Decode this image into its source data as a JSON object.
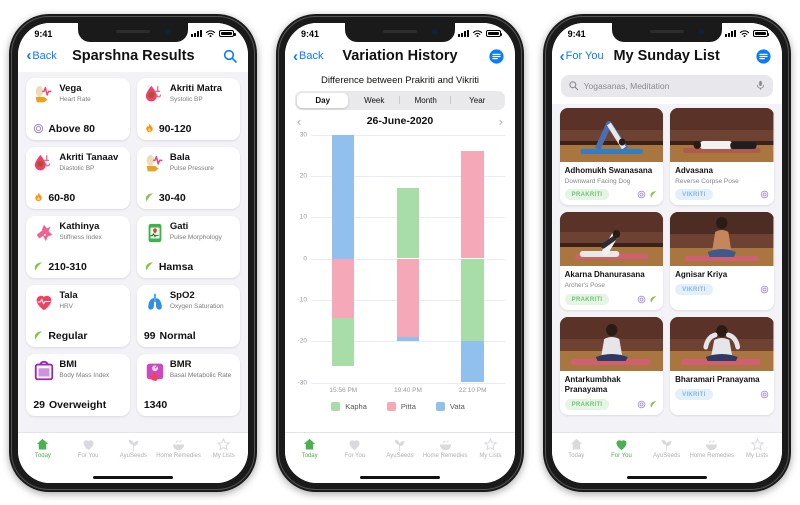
{
  "phones": [
    {
      "id": "sparshna-results",
      "status": {
        "time": "9:41"
      },
      "nav": {
        "back": "Back",
        "title": "Sparshna Results",
        "right_icon": "search-icon"
      },
      "cards": [
        {
          "title": "Vega",
          "sub": "Heart Rate",
          "icon": "pulse-hand-icon",
          "value_icon": "spiral-icon",
          "value": "Above 80"
        },
        {
          "title": "Akriti Matra",
          "sub": "Systolic BP",
          "icon": "blood-drop-icon",
          "value_icon": "flame-icon",
          "value": "90-120"
        },
        {
          "title": "Akriti Tanaav",
          "sub": "Diastolic BP",
          "icon": "blood-drop-icon",
          "value_icon": "flame-icon",
          "value": "60-80"
        },
        {
          "title": "Bala",
          "sub": "Pulse Pressure",
          "icon": "pulse-hand-icon",
          "value_icon": "leaf-icon",
          "value": "30-40"
        },
        {
          "title": "Kathinya",
          "sub": "Stiffness Index",
          "icon": "artery-icon",
          "value_icon": "leaf-icon",
          "value": "210-310"
        },
        {
          "title": "Gati",
          "sub": "Pulse Morphology",
          "icon": "phone-ecg-icon",
          "value_icon": "leaf-icon",
          "value": "Hamsa"
        },
        {
          "title": "Tala",
          "sub": "HRV",
          "icon": "heart-icon",
          "value_icon": "leaf-icon",
          "value": "Regular"
        },
        {
          "title": "SpO2",
          "sub": "Oxygen Saturation",
          "icon": "lungs-icon",
          "value_icon": "",
          "value": "99",
          "unit": "Normal"
        },
        {
          "title": "BMI",
          "sub": "Body Mass Index",
          "icon": "clipboard-icon",
          "value_icon": "",
          "value": "29",
          "unit": "Overweight"
        },
        {
          "title": "BMR",
          "sub": "Basal Metabolic Rate",
          "icon": "scale-flame-icon",
          "value_icon": "",
          "value": "1340",
          "unit": ""
        }
      ],
      "tabs": [
        {
          "label": "Today",
          "icon": "home-icon",
          "active": true
        },
        {
          "label": "For You",
          "icon": "heart-icon",
          "active": false
        },
        {
          "label": "AyuSeeds",
          "icon": "sprout-icon",
          "active": false
        },
        {
          "label": "Home Remedies",
          "icon": "bowl-icon",
          "active": false
        },
        {
          "label": "My Lists",
          "icon": "star-icon",
          "active": false
        }
      ]
    },
    {
      "id": "variation-history",
      "status": {
        "time": "9:41"
      },
      "nav": {
        "back": "Back",
        "title": "Variation History",
        "right_icon": "list-circle-icon"
      },
      "subtitle": "Difference between Prakriti and Vikriti",
      "segments": [
        {
          "label": "Day",
          "selected": true
        },
        {
          "label": "Week",
          "selected": false
        },
        {
          "label": "Month",
          "selected": false
        },
        {
          "label": "Year",
          "selected": false
        }
      ],
      "date": "26-June-2020",
      "tabs": [
        {
          "label": "Today",
          "icon": "home-icon",
          "active": true
        },
        {
          "label": "For You",
          "icon": "heart-icon",
          "active": false
        },
        {
          "label": "AyuSeeds",
          "icon": "sprout-icon",
          "active": false
        },
        {
          "label": "Home Remedies",
          "icon": "bowl-icon",
          "active": false
        },
        {
          "label": "My Lists",
          "icon": "star-icon",
          "active": false
        }
      ]
    },
    {
      "id": "my-sunday-list",
      "status": {
        "time": "9:41"
      },
      "nav": {
        "back": "For You",
        "title": "My Sunday List",
        "right_icon": "list-circle-icon"
      },
      "search": {
        "placeholder": "Yogasanas, Meditation",
        "icon": "search-icon",
        "mic_icon": "microphone-icon"
      },
      "items": [
        {
          "name": "Adhomukh Swanasana",
          "desc": "Downward Facing Dog",
          "pill": "PRAKRITI",
          "pill_type": "prakriti",
          "icons": [
            "spiral-icon",
            "leaf-icon"
          ],
          "pose": "downward-dog"
        },
        {
          "name": "Advasana",
          "desc": "Reverse Corpse Pose",
          "pill": "VIKRITI",
          "pill_type": "vikriti",
          "icons": [
            "spiral-icon"
          ],
          "pose": "prone-lying"
        },
        {
          "name": "Akarna Dhanurasana",
          "desc": "Archer's Pose",
          "pill": "PRAKRITI",
          "pill_type": "prakriti",
          "icons": [
            "spiral-icon",
            "leaf-icon"
          ],
          "pose": "seated-archer"
        },
        {
          "name": "Agnisar Kriya",
          "desc": "",
          "pill": "VIKRITI",
          "pill_type": "vikriti",
          "icons": [
            "spiral-icon"
          ],
          "pose": "seated-shirtless"
        },
        {
          "name": "Antarkumbhak Pranayama",
          "desc": "",
          "pill": "PRAKRITI",
          "pill_type": "prakriti",
          "icons": [
            "spiral-icon",
            "leaf-icon"
          ],
          "pose": "seated-meditate"
        },
        {
          "name": "Bharamari Pranayama",
          "desc": "",
          "pill": "VIKRITI",
          "pill_type": "vikriti",
          "icons": [
            "spiral-icon"
          ],
          "pose": "seated-ears"
        }
      ],
      "tabs": [
        {
          "label": "Today",
          "icon": "home-icon",
          "active": false
        },
        {
          "label": "For You",
          "icon": "heart-icon",
          "active": true
        },
        {
          "label": "AyuSeeds",
          "icon": "sprout-icon",
          "active": false
        },
        {
          "label": "Home Remedies",
          "icon": "bowl-icon",
          "active": false
        },
        {
          "label": "My Lists",
          "icon": "star-icon",
          "active": false
        }
      ]
    }
  ],
  "chart_data": {
    "type": "bar",
    "subtype": "stacked-diverging",
    "title": "Variation History",
    "subtitle": "Difference between Prakriti and Vikriti",
    "xlabel": "",
    "ylabel": "",
    "ylim": [
      -30,
      30
    ],
    "yticks": [
      30,
      20,
      10,
      0,
      -10,
      -20,
      -30
    ],
    "grid": true,
    "legend_position": "bottom",
    "categories": [
      "15:56 PM",
      "19:40 PM",
      "22:10 PM"
    ],
    "series": [
      {
        "name": "Kapha",
        "color": "#a8dda8",
        "values": [
          -11.5,
          17,
          20
        ]
      },
      {
        "name": "Pitta",
        "color": "#f5a9b8",
        "values": [
          -14.5,
          -19,
          26
        ]
      },
      {
        "name": "Vata",
        "color": "#92c0ee",
        "values": [
          30,
          -1,
          -10
        ]
      }
    ],
    "bars": [
      {
        "category": "15:56 PM",
        "stacks": [
          {
            "name": "Vata",
            "from": 0,
            "to": 30,
            "color": "#92c0ee"
          },
          {
            "name": "Pitta",
            "from": -14.5,
            "to": 0,
            "color": "#f5a9b8"
          },
          {
            "name": "Kapha",
            "from": -26,
            "to": -14.5,
            "color": "#a8dda8"
          }
        ]
      },
      {
        "category": "19:40 PM",
        "stacks": [
          {
            "name": "Kapha",
            "from": 0,
            "to": 17,
            "color": "#a8dda8"
          },
          {
            "name": "Pitta",
            "from": -19,
            "to": 0,
            "color": "#f5a9b8"
          },
          {
            "name": "Vata",
            "from": -20,
            "to": -19,
            "color": "#92c0ee"
          }
        ]
      },
      {
        "category": "22:10 PM",
        "stacks": [
          {
            "name": "Pitta",
            "from": 0,
            "to": 26,
            "color": "#f5a9b8"
          },
          {
            "name": "Kapha",
            "from": -20,
            "to": 0,
            "color": "#a8dda8"
          },
          {
            "name": "Vata",
            "from": -30,
            "to": -20,
            "color": "#92c0ee"
          }
        ]
      }
    ]
  },
  "colors": {
    "accent_blue": "#0a7bff",
    "tab_active_green": "#4caf50",
    "kapha": "#a8dda8",
    "pitta": "#f5a9b8",
    "vata": "#92c0ee",
    "screen_bg": "#f2f2f7"
  }
}
